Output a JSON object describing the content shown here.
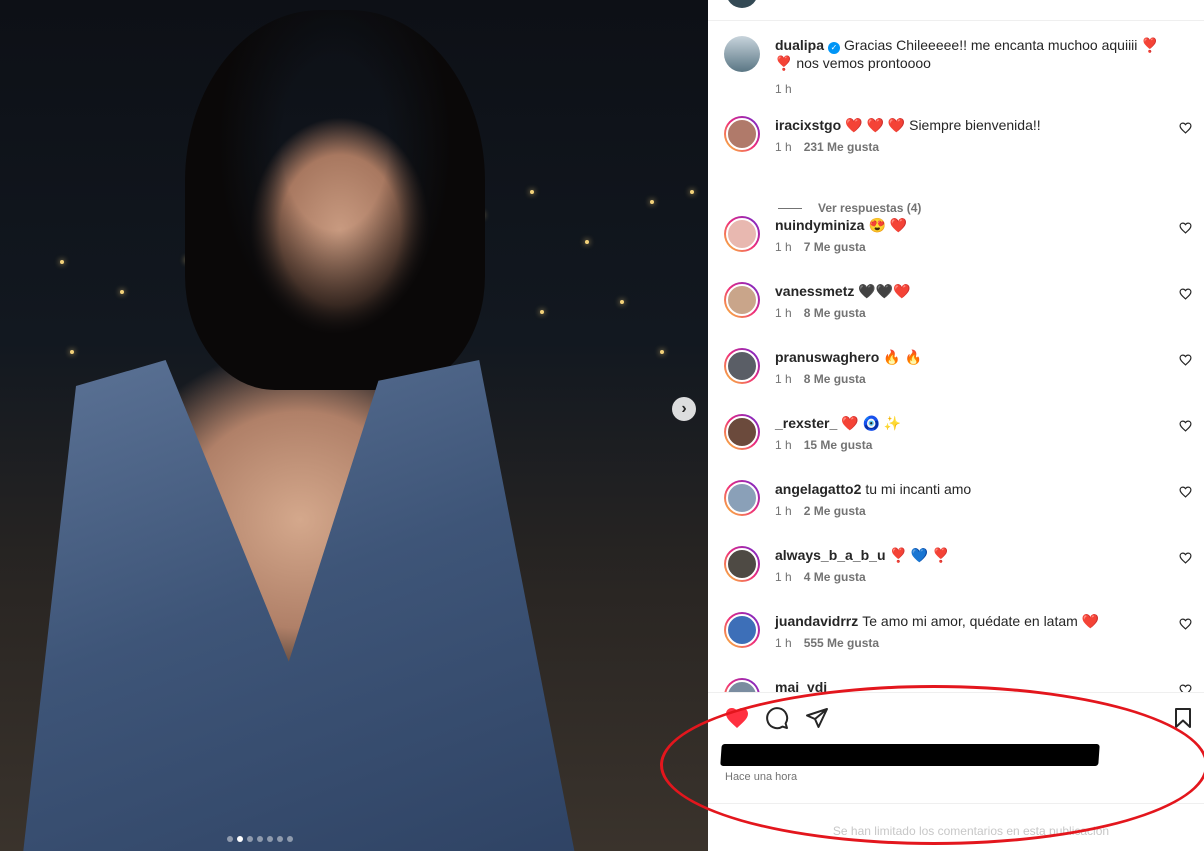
{
  "post": {
    "author": "dualipa",
    "caption": "Gracias Chileeeee!! me encanta muchoo aquiiii ❣️ ❣️ nos vemos prontoooo",
    "caption_time": "1 h"
  },
  "comments": [
    {
      "user": "iracixstgo",
      "text": "❤️ ❤️ ❤️  Siempre bienvenida!!",
      "time": "1 h",
      "likes": "231 Me gusta",
      "avatar_color": "#b07a6a",
      "replies": "Ver respuestas (4)"
    },
    {
      "user": "nuindyminiza",
      "text": "😍 ❤️",
      "time": "1 h",
      "likes": "7 Me gusta",
      "avatar_color": "#e8b8b0"
    },
    {
      "user": "vanessmetz",
      "text": "🖤🖤❤️",
      "time": "1 h",
      "likes": "8 Me gusta",
      "avatar_color": "#c9a58a"
    },
    {
      "user": "pranuswaghero",
      "text": "🔥 🔥",
      "time": "1 h",
      "likes": "8 Me gusta",
      "avatar_color": "#5a5e66"
    },
    {
      "user": "_rexster_",
      "text": "❤️ 🧿 ✨",
      "time": "1 h",
      "likes": "15 Me gusta",
      "avatar_color": "#6b4a3c"
    },
    {
      "user": "angelagatto2",
      "text": "tu mi incanti amo",
      "time": "1 h",
      "likes": "2 Me gusta",
      "avatar_color": "#8aa0b8"
    },
    {
      "user": "always_b_a_b_u",
      "text": "❣️ 💙 ❣️",
      "time": "1 h",
      "likes": "4 Me gusta",
      "avatar_color": "#4e4a44"
    },
    {
      "user": "juandavidrrz",
      "text": "Te amo mi amor, quédate en latam ❤️",
      "time": "1 h",
      "likes": "555 Me gusta",
      "avatar_color": "#3d6fb8"
    },
    {
      "user": "mai_ydi",
      "text": "",
      "time": "",
      "likes": "",
      "avatar_color": "#7a8ca0"
    }
  ],
  "footer": {
    "time_ago": "Hace una hora",
    "limited_notice": "Se han limitado los comentarios en esta publicación"
  },
  "icons": {
    "next": "chevron-right-icon",
    "like": "heart-filled-icon",
    "comment": "comment-icon",
    "share": "send-icon",
    "save": "bookmark-icon"
  },
  "colors": {
    "like_red": "#ff3040",
    "annotation_red": "#e3161d",
    "verified_blue": "#0095f6"
  },
  "carousel": {
    "count": 7,
    "active": 1
  }
}
